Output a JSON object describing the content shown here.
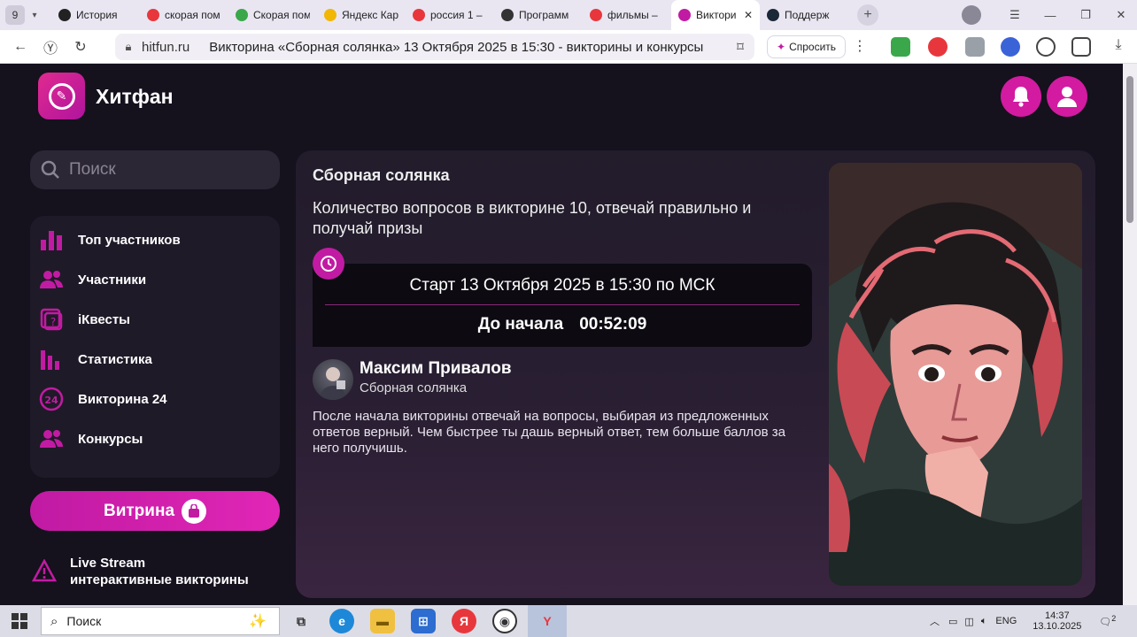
{
  "browser": {
    "tab_count": "9",
    "tabs": [
      {
        "label": "История",
        "icon": "history-icon",
        "color": "#222222"
      },
      {
        "label": "скорая пом",
        "icon": "yandex-icon",
        "color": "#e8373c"
      },
      {
        "label": "Скорая пом",
        "icon": "hd-icon",
        "color": "#3aa84a"
      },
      {
        "label": "Яндекс Кар",
        "icon": "maps-icon",
        "color": "#f2b705"
      },
      {
        "label": "россия 1 –",
        "icon": "yandex-icon",
        "color": "#e8373c"
      },
      {
        "label": "Программ",
        "icon": "tv-icon",
        "color": "#333333"
      },
      {
        "label": "фильмы –",
        "icon": "yandex-icon",
        "color": "#e8373c"
      },
      {
        "label": "Виктори",
        "icon": "hitfun-icon",
        "color": "#c21ba3"
      },
      {
        "label": "Поддерж",
        "icon": "steam-icon",
        "color": "#1b2838"
      }
    ],
    "domain": "hitfun.ru",
    "page_title": "Викторина «Сборная солянка» 13 Октября 2025 в 15:30 - викторины и конкурсы",
    "ask_label": "Спросить"
  },
  "site": {
    "brand": "Хитфан",
    "search_placeholder": "Поиск",
    "nav": [
      {
        "label": "Топ участников",
        "icon": "bar-chart-icon"
      },
      {
        "label": "Участники",
        "icon": "users-icon"
      },
      {
        "label": "iКвесты",
        "icon": "quest-icon"
      },
      {
        "label": "Статистика",
        "icon": "stats-icon"
      },
      {
        "label": "Викторина 24",
        "icon": "quiz24-icon"
      },
      {
        "label": "Конкурсы",
        "icon": "contest-icon"
      }
    ],
    "vitrina_label": "Витрина",
    "live_line1": "Live Stream",
    "live_line2": "интерактивные викторины",
    "accent": "#c21ba3"
  },
  "quiz": {
    "title": "Сборная солянка",
    "description": "Количество вопросов в викторине 10, отвечай правильно и получай призы",
    "start_text": "Старт 13 Октября 2025 в 15:30 по МСК",
    "until_label": "До начала",
    "countdown": "00:52:09",
    "author_name": "Максим Привалов",
    "author_subtitle": "Сборная солянка",
    "rules": "После начала викторины отвечай на вопросы, выбирая из предложенных ответов верный. Чем быстрее ты дашь верный ответ, тем больше баллов за него получишь."
  },
  "taskbar": {
    "search_label": "Поиск",
    "lang": "ENG",
    "time": "14:37",
    "date": "13.10.2025",
    "notifications": "2"
  }
}
